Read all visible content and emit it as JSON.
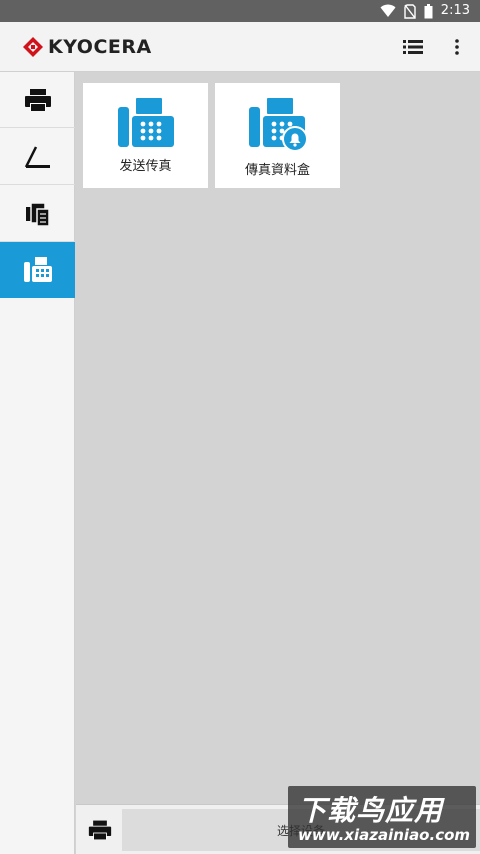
{
  "status_bar": {
    "time": "2:13"
  },
  "app_bar": {
    "brand": "KYOCERA"
  },
  "tiles": [
    {
      "label": "发送传真"
    },
    {
      "label": "傳真資料盒"
    }
  ],
  "bottom_bar": {
    "device_label": "选择设备"
  },
  "watermark": {
    "title": "下载鸟应用",
    "url": "www.xiazainiao.com"
  },
  "colors": {
    "accent": "#1a9ad6",
    "brand_red": "#d1121b",
    "status_bar": "#616161",
    "content_bg": "#d3d3d3"
  }
}
